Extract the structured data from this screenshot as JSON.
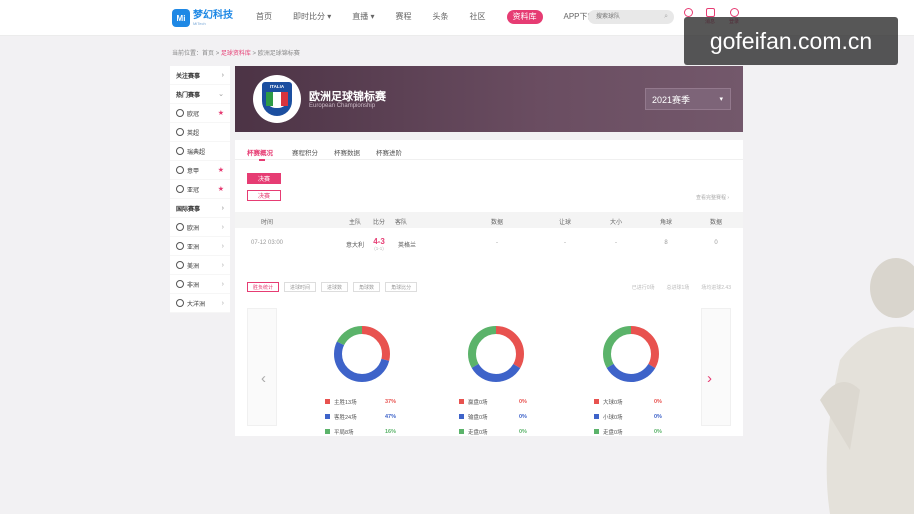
{
  "header": {
    "logo_mark": "Mi",
    "logo_text": "梦幻科技",
    "logo_sub": "MiTech",
    "nav": [
      "首页",
      "即时比分 ▾",
      "直播 ▾",
      "赛程",
      "头条",
      "社区",
      "资料库",
      "APP下载"
    ],
    "active_nav_index": 6,
    "search_placeholder": "搜索球队",
    "icons": [
      {
        "name": "user-icon",
        "label": ""
      },
      {
        "name": "message-icon",
        "label": "消息"
      },
      {
        "name": "account-icon",
        "label": "登录"
      }
    ]
  },
  "watermark": "gofeifan.com.cn",
  "breadcrumb": {
    "prefix": "当前位置：",
    "home": "首页",
    "sep": " > ",
    "db": "足球资料库",
    "current": "欧洲足球锦标赛"
  },
  "sidebar": [
    {
      "label": "关注赛事",
      "kind": "header",
      "mark": "›"
    },
    {
      "label": "热门赛事",
      "kind": "header",
      "mark": "⌄"
    },
    {
      "label": "欧冠",
      "kind": "item",
      "mark": "★"
    },
    {
      "label": "英超",
      "kind": "item",
      "mark": ""
    },
    {
      "label": "瑞典超",
      "kind": "item",
      "mark": ""
    },
    {
      "label": "意甲",
      "kind": "item",
      "mark": "★"
    },
    {
      "label": "亚冠",
      "kind": "item",
      "mark": "★"
    },
    {
      "label": "国际赛事",
      "kind": "header",
      "mark": "›"
    },
    {
      "label": "欧洲",
      "kind": "item",
      "mark": "›"
    },
    {
      "label": "亚洲",
      "kind": "item",
      "mark": "›"
    },
    {
      "label": "美洲",
      "kind": "item",
      "mark": "›"
    },
    {
      "label": "非洲",
      "kind": "item",
      "mark": "›"
    },
    {
      "label": "大洋洲",
      "kind": "item",
      "mark": "›"
    }
  ],
  "banner": {
    "badge_word": "ITALIA",
    "title": "欧洲足球锦标赛",
    "subtitle": "European Championship",
    "season": "2021赛季",
    "season_caret": "▾"
  },
  "tabs": [
    "杯赛概况",
    "赛程积分",
    "杯赛数据",
    "杯赛进阶"
  ],
  "stages": [
    {
      "label": "决赛",
      "active": true
    },
    {
      "label": "决赛",
      "active": false
    }
  ],
  "more_link": "查看完整赛程 ›",
  "table": {
    "headers": [
      "时间",
      "主队",
      "比分",
      "客队",
      "数据",
      "让球",
      "大小",
      "角球",
      "数据"
    ],
    "rows": [
      {
        "time": "07-12 03:00",
        "home": "意大利",
        "score": "4-3",
        "half": "(1-1)",
        "away": "英格兰",
        "data": "-",
        "handicap": "-",
        "ou": "-",
        "corner": "8",
        "stats": "0"
      }
    ]
  },
  "filters": [
    "胜负统计",
    "进球时间",
    "进球数",
    "角球数",
    "角球比分"
  ],
  "filter_rights": [
    "已进行0场",
    "总进球1场",
    "场均进球2.43"
  ],
  "chart_data": [
    {
      "type": "pie",
      "title": "",
      "slices": [
        {
          "label": "主胜13场",
          "value": 13,
          "pct": "37%",
          "color": "#e8524f"
        },
        {
          "label": "客胜24场",
          "value": 24,
          "pct": "47%",
          "color": "#3e63c9"
        },
        {
          "label": "平局8场",
          "value": 8,
          "pct": "16%",
          "color": "#5bb36a"
        }
      ]
    },
    {
      "type": "pie",
      "title": "",
      "slices": [
        {
          "label": "赢盘0场",
          "value": 0,
          "pct": "0%",
          "color": "#e8524f"
        },
        {
          "label": "输盘0场",
          "value": 0,
          "pct": "0%",
          "color": "#3e63c9"
        },
        {
          "label": "走盘0场",
          "value": 0,
          "pct": "0%",
          "color": "#5bb36a"
        }
      ]
    },
    {
      "type": "pie",
      "title": "",
      "slices": [
        {
          "label": "大球0场",
          "value": 0,
          "pct": "0%",
          "color": "#e8524f"
        },
        {
          "label": "小球0场",
          "value": 0,
          "pct": "0%",
          "color": "#3e63c9"
        },
        {
          "label": "走盘0场",
          "value": 0,
          "pct": "0%",
          "color": "#5bb36a"
        }
      ]
    }
  ],
  "colors": {
    "accent": "#e63c73",
    "brand": "#1e88e5",
    "banner": "#5a3f53"
  },
  "carousel": {
    "prev": "‹",
    "next": "›"
  }
}
